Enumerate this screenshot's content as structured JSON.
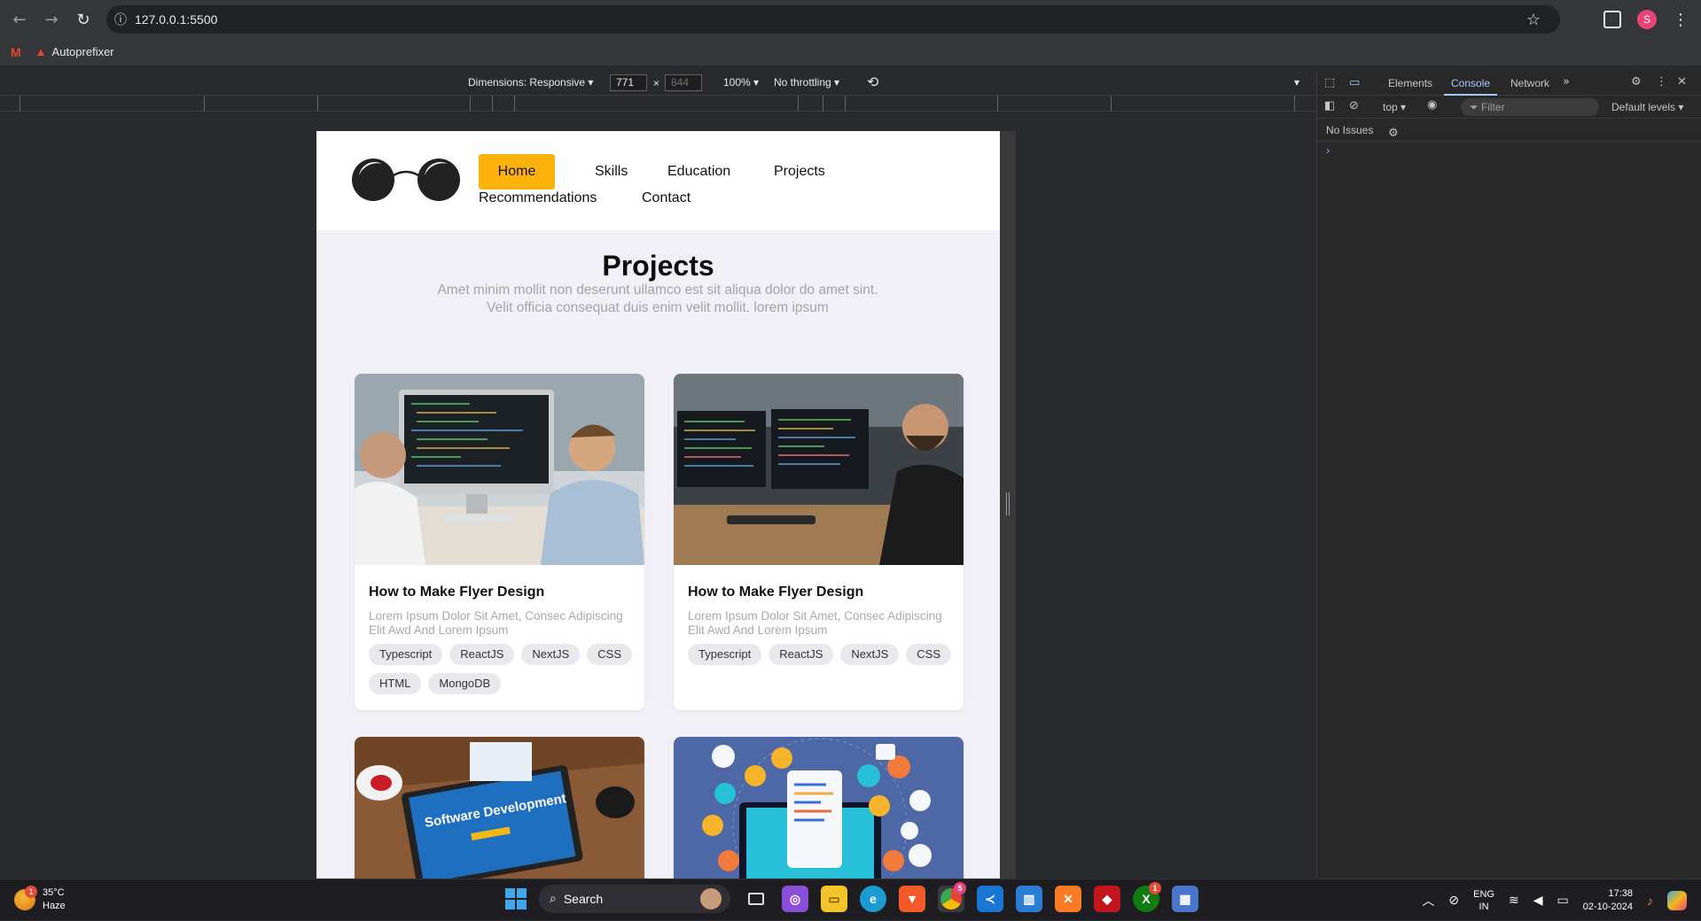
{
  "browser": {
    "url": "127.0.0.1:5500",
    "bookmarks": [
      {
        "label": ""
      },
      {
        "label": "Autoprefixer"
      }
    ],
    "profile_initial": "S"
  },
  "device_toolbar": {
    "dimensions_label": "Dimensions: Responsive",
    "width": "771",
    "times": "×",
    "height": "844",
    "zoom": "100%",
    "throttling": "No throttling"
  },
  "site": {
    "nav": {
      "home": "Home",
      "skills": "Skills",
      "education": "Education",
      "projects": "Projects",
      "recommendations": "Recommendations",
      "contact": "Contact"
    },
    "section_title": "Projects",
    "section_subtitle": "Amet minim mollit non deserunt ullamco est sit aliqua dolor do amet sint. Velit officia consequat duis enim velit mollit. lorem ipsum",
    "cards": [
      {
        "title": "How to Make Flyer Design",
        "description": "Lorem Ipsum Dolor Sit Amet, Consec Adipiscing Elit Awd And Lorem Ipsum",
        "tags": [
          "Typescript",
          "ReactJS",
          "NextJS",
          "CSS",
          "HTML",
          "MongoDB"
        ]
      },
      {
        "title": "How to Make Flyer Design",
        "description": "Lorem Ipsum Dolor Sit Amet, Consec Adipiscing Elit Awd And Lorem Ipsum",
        "tags": [
          "Typescript",
          "ReactJS",
          "NextJS",
          "CSS"
        ]
      },
      {
        "image_text": "Software Development"
      },
      {}
    ]
  },
  "devtools": {
    "tabs": {
      "elements": "Elements",
      "console": "Console",
      "network": "Network"
    },
    "context": "top",
    "filter_placeholder": "Filter",
    "levels": "Default levels",
    "issues": "No Issues",
    "prompt": "›"
  },
  "taskbar": {
    "weather_temp": "35°C",
    "weather_desc": "Haze",
    "weather_badge": "1",
    "search_label": "Search",
    "chrome_badge": "5",
    "xbox_badge": "1",
    "lang_top": "ENG",
    "lang_bottom": "IN",
    "time": "17:38",
    "date": "02-10-2024"
  },
  "colors": {
    "accent_nav": "#fcb20c",
    "viewport_bg": "#f1f0f6",
    "devtools_active": "#a8c7fa"
  }
}
